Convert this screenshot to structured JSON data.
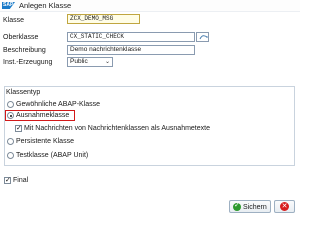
{
  "window": {
    "title": "Anlegen Klasse"
  },
  "form": {
    "klasse_label": "Klasse",
    "klasse_value": "ZCX_DEMO_MSG",
    "oberklasse_label": "Oberklasse",
    "oberklasse_value": "CX_STATIC_CHECK",
    "beschreibung_label": "Beschreibung",
    "beschreibung_value": "Demo nachrichtenklasse",
    "inst_label": "Inst.-Erzeugung",
    "inst_value": "Public"
  },
  "klassentyp": {
    "title": "Klassentyp",
    "options": [
      {
        "label": "Gewöhnliche ABAP-Klasse",
        "selected": false
      },
      {
        "label": "Ausnahmeklasse",
        "selected": true
      },
      {
        "label": "Persistente Klasse",
        "selected": false
      },
      {
        "label": "Testklasse (ABAP Unit)",
        "selected": false
      }
    ],
    "with_messages_label": "Mit Nachrichten von Nachrichtenklassen als Ausnahmetexte",
    "with_messages_checked": true
  },
  "final": {
    "label": "Final",
    "checked": true
  },
  "buttons": {
    "save_label": "Sichern"
  },
  "colors": {
    "highlight": "#d21919",
    "save_icon": "#2e9a2e",
    "cancel_icon": "#d81e1e"
  }
}
